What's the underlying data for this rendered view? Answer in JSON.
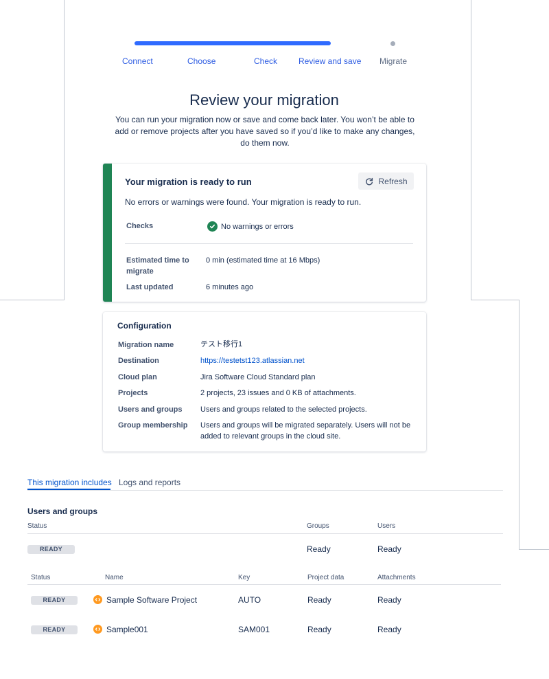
{
  "stepper": {
    "steps": [
      {
        "label": "Connect",
        "state": "done"
      },
      {
        "label": "Choose",
        "state": "done"
      },
      {
        "label": "Check",
        "state": "done"
      },
      {
        "label": "Review and save",
        "state": "current"
      },
      {
        "label": "Migrate",
        "state": "pending"
      }
    ]
  },
  "header": {
    "title": "Review your migration",
    "subtitle": "You can run your migration now or save and come back later. You won’t be able to add or remove projects after you have saved so if you’d like to make any changes, do them now."
  },
  "ready_card": {
    "heading": "Your migration is ready to run",
    "refresh_label": "Refresh",
    "message": "No errors or warnings were found. Your migration is ready to run.",
    "checks_label": "Checks",
    "checks_value": "No warnings or errors",
    "estimated_label": "Estimated time to migrate",
    "estimated_value": "0 min (estimated time at 16 Mbps)",
    "last_updated_label": "Last updated",
    "last_updated_value": "6 minutes ago"
  },
  "configuration": {
    "heading": "Configuration",
    "rows": [
      {
        "key": "Migration name",
        "value": "テスト移行1"
      },
      {
        "key": "Destination",
        "value": "https://testetst123.atlassian.net"
      },
      {
        "key": "Cloud plan",
        "value": "Jira Software Cloud Standard plan"
      },
      {
        "key": "Projects",
        "value": "2 projects, 23 issues and 0 KB of attachments."
      },
      {
        "key": "Users and groups",
        "value": "Users and groups related to the selected projects."
      },
      {
        "key": "Group membership",
        "value": "Users and groups will be migrated separately. Users will not be added to relevant groups in the cloud site."
      }
    ]
  },
  "tabs": [
    {
      "label": "This migration includes",
      "active": true
    },
    {
      "label": "Logs and reports",
      "active": false
    }
  ],
  "users_groups": {
    "title": "Users and groups",
    "headers": {
      "status": "Status",
      "groups": "Groups",
      "users": "Users"
    },
    "row": {
      "status": "READY",
      "groups": "Ready",
      "users": "Ready"
    }
  },
  "projects": {
    "headers": {
      "status": "Status",
      "name": "Name",
      "key": "Key",
      "project_data": "Project data",
      "attachments": "Attachments"
    },
    "rows": [
      {
        "status": "READY",
        "name": "Sample Software Project",
        "key": "AUTO",
        "project_data": "Ready",
        "attachments": "Ready"
      },
      {
        "status": "READY",
        "name": "Sample001",
        "key": "SAM001",
        "project_data": "Ready",
        "attachments": "Ready"
      }
    ]
  },
  "colors": {
    "accent": "#0052cc",
    "progress": "#2f6bff",
    "success": "#1f8454",
    "project_icon": "#ff991f"
  },
  "icons": {
    "refresh": "refresh-icon",
    "check": "check-circle-icon",
    "project": "project-avatar-icon"
  }
}
